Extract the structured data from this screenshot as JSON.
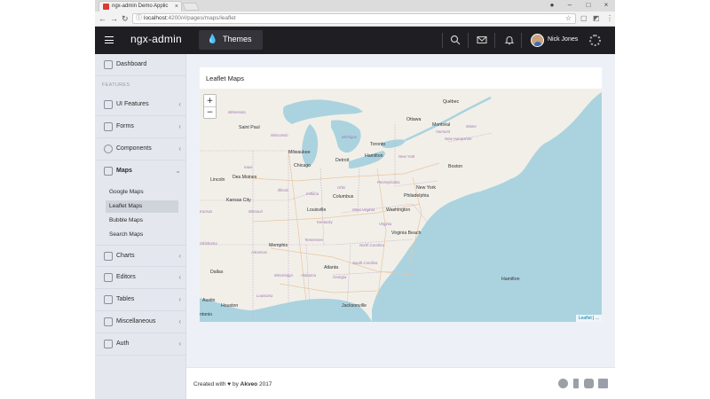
{
  "browser": {
    "tab_title": "ngx-admin Demo Applic",
    "url_host": "localhost",
    "url_rest": ":4200/#/pages/maps/leaflet",
    "icons": [
      "back-icon",
      "forward-icon",
      "reload-icon",
      "info-icon",
      "star-icon",
      "extension-icon",
      "menu-icon",
      "minimize-icon",
      "maximize-icon",
      "close-icon"
    ]
  },
  "header": {
    "logo": "ngx-admin",
    "themes_label": "Themes",
    "user_name": "Nick Jones",
    "icons": [
      "menu-icon",
      "drop-icon",
      "search-icon",
      "mail-icon",
      "bell-icon",
      "gear-icon"
    ]
  },
  "sidebar": {
    "dashboard": "Dashboard",
    "group_label": "FEATURES",
    "items": [
      {
        "label": "UI Features",
        "icon": "keypad-icon"
      },
      {
        "label": "Forms",
        "icon": "compose-icon"
      },
      {
        "label": "Components",
        "icon": "gear-icon"
      },
      {
        "label": "Maps",
        "icon": "location-icon",
        "expanded": true
      },
      {
        "label": "Charts",
        "icon": "chart-icon"
      },
      {
        "label": "Editors",
        "icon": "editor-icon"
      },
      {
        "label": "Tables",
        "icon": "table-icon"
      },
      {
        "label": "Miscellaneous",
        "icon": "shuffle-icon"
      },
      {
        "label": "Auth",
        "icon": "lock-icon"
      }
    ],
    "maps_sub": [
      {
        "label": "Google Maps"
      },
      {
        "label": "Leaflet Maps",
        "active": true
      },
      {
        "label": "Bubble Maps"
      },
      {
        "label": "Search Maps"
      }
    ]
  },
  "card": {
    "title": "Leaflet Maps",
    "zoom_in": "+",
    "zoom_out": "−",
    "attribution_link": "Leaflet",
    "attribution_rest": " | ..."
  },
  "map_labels": {
    "quebec": "Québec",
    "ottawa": "Ottawa",
    "montreal": "Montréal",
    "minnesota": "Minnesota",
    "saint_paul": "Saint Paul",
    "maine": "Maine",
    "wisconsin": "Wisconsin",
    "michigan": "Michigan",
    "toronto": "Toronto",
    "vermont": "Vermont",
    "new_hampshire": "New Hampshire",
    "milwaukee": "Milwaukee",
    "hamilton_on": "Hamilton",
    "new_york_state": "New York",
    "iowa": "Iowa",
    "chicago": "Chicago",
    "detroit": "Detroit",
    "boston": "Boston",
    "lincoln": "Lincoln",
    "des_moines": "Des Moines",
    "pennsylvania": "Pennsylvania",
    "illinois": "Illinois",
    "indiana": "Indiana",
    "ohio": "Ohio",
    "new_york": "New York",
    "philadelphia": "Philadelphia",
    "kansas_city": "Kansas City",
    "columbus": "Columbus",
    "missouri": "Missouri",
    "louisville": "Louisville",
    "west_virginia": "West Virginia",
    "washington": "Washington",
    "kansas": "Kansas",
    "kentucky": "Kentucky",
    "virginia": "Virginia",
    "oklahoma": "Oklahoma",
    "memphis": "Memphis",
    "tennessee": "Tennessee",
    "north_carolina": "North Carolina",
    "arkansas": "Arkansas",
    "virginia_beach": "Virginia Beach",
    "south_carolina": "South Carolina",
    "atlanta": "Atlanta",
    "dallas": "Dallas",
    "mississippi": "Mississippi",
    "alabama": "Alabama",
    "georgia": "Georgia",
    "hamilton_bm": "Hamilton",
    "louisiana": "Louisiana",
    "austin": "Austin",
    "houston": "Houston",
    "jacksonville": "Jacksonville",
    "san_antonio": "ntonio"
  },
  "footer": {
    "created_prefix": "Created with ♥ by ",
    "brand": "Akveo",
    "year": " 2017",
    "icons": [
      "github-icon",
      "facebook-icon",
      "twitter-icon",
      "linkedin-icon"
    ]
  },
  "colors": {
    "header_bg": "#1f1f23",
    "sidebar_bg": "#e4e8ee",
    "content_bg": "#edf1f7",
    "water": "#aad3df",
    "land": "#f2efe9",
    "accent_tab": "#dd3b33"
  }
}
